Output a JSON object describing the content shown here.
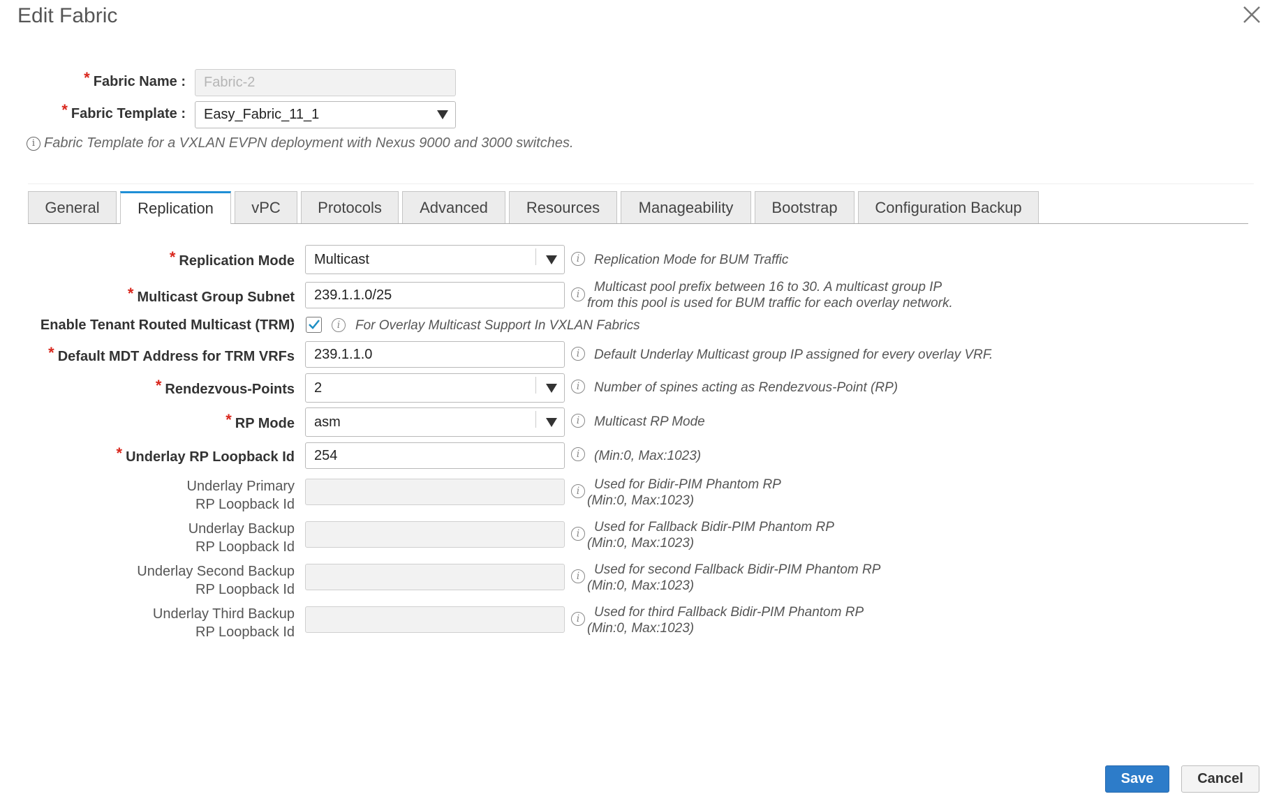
{
  "dialog": {
    "title": "Edit Fabric",
    "close_icon": "close-icon"
  },
  "header": {
    "fabric_name_label": "Fabric Name :",
    "fabric_name_value": "Fabric-2",
    "fabric_template_label": "Fabric Template :",
    "fabric_template_value": "Easy_Fabric_11_1",
    "template_note": "Fabric Template for a VXLAN EVPN deployment with Nexus 9000 and 3000 switches."
  },
  "tabs": [
    {
      "label": "General"
    },
    {
      "label": "Replication"
    },
    {
      "label": "vPC"
    },
    {
      "label": "Protocols"
    },
    {
      "label": "Advanced"
    },
    {
      "label": "Resources"
    },
    {
      "label": "Manageability"
    },
    {
      "label": "Bootstrap"
    },
    {
      "label": "Configuration Backup"
    }
  ],
  "active_tab": "Replication",
  "form": {
    "replication_mode": {
      "label": "Replication Mode",
      "value": "Multicast",
      "help": "Replication Mode for BUM Traffic"
    },
    "multicast_group_subnet": {
      "label": "Multicast Group Subnet",
      "value": "239.1.1.0/25",
      "help_line1": "Multicast pool prefix between 16 to 30. A multicast group IP",
      "help_line2": "from this pool is used for BUM traffic for each overlay network."
    },
    "enable_trm": {
      "label": "Enable Tenant Routed Multicast (TRM)",
      "checked": true,
      "help": "For Overlay Multicast Support In VXLAN Fabrics"
    },
    "default_mdt": {
      "label": "Default MDT Address for TRM VRFs",
      "value": "239.1.1.0",
      "help": "Default Underlay Multicast group IP assigned for every overlay VRF."
    },
    "rendezvous_points": {
      "label": "Rendezvous-Points",
      "value": "2",
      "help": "Number of spines acting as Rendezvous-Point (RP)"
    },
    "rp_mode": {
      "label": "RP Mode",
      "value": "asm",
      "help": "Multicast RP Mode"
    },
    "underlay_rp_loopback": {
      "label": "Underlay RP Loopback Id",
      "value": "254",
      "help": "(Min:0, Max:1023)"
    },
    "underlay_primary_rp": {
      "label_line1": "Underlay Primary",
      "label_line2": "RP Loopback Id",
      "value": "",
      "help_line1": "Used for Bidir-PIM Phantom RP",
      "help_line2": "(Min:0, Max:1023)"
    },
    "underlay_backup_rp": {
      "label_line1": "Underlay Backup",
      "label_line2": "RP Loopback Id",
      "value": "",
      "help_line1": "Used for Fallback Bidir-PIM Phantom RP",
      "help_line2": "(Min:0, Max:1023)"
    },
    "underlay_second_backup_rp": {
      "label_line1": "Underlay Second Backup",
      "label_line2": "RP Loopback Id",
      "value": "",
      "help_line1": "Used for second Fallback Bidir-PIM Phantom RP",
      "help_line2": "(Min:0, Max:1023)"
    },
    "underlay_third_backup_rp": {
      "label_line1": "Underlay Third Backup",
      "label_line2": "RP Loopback Id",
      "value": "",
      "help_line1": "Used for third Fallback Bidir-PIM Phantom RP",
      "help_line2": "(Min:0, Max:1023)"
    }
  },
  "footer": {
    "save_label": "Save",
    "cancel_label": "Cancel"
  },
  "colors": {
    "accent": "#2d7cc9",
    "required": "#d9261c",
    "active_tab_border": "#1f8fd6"
  }
}
